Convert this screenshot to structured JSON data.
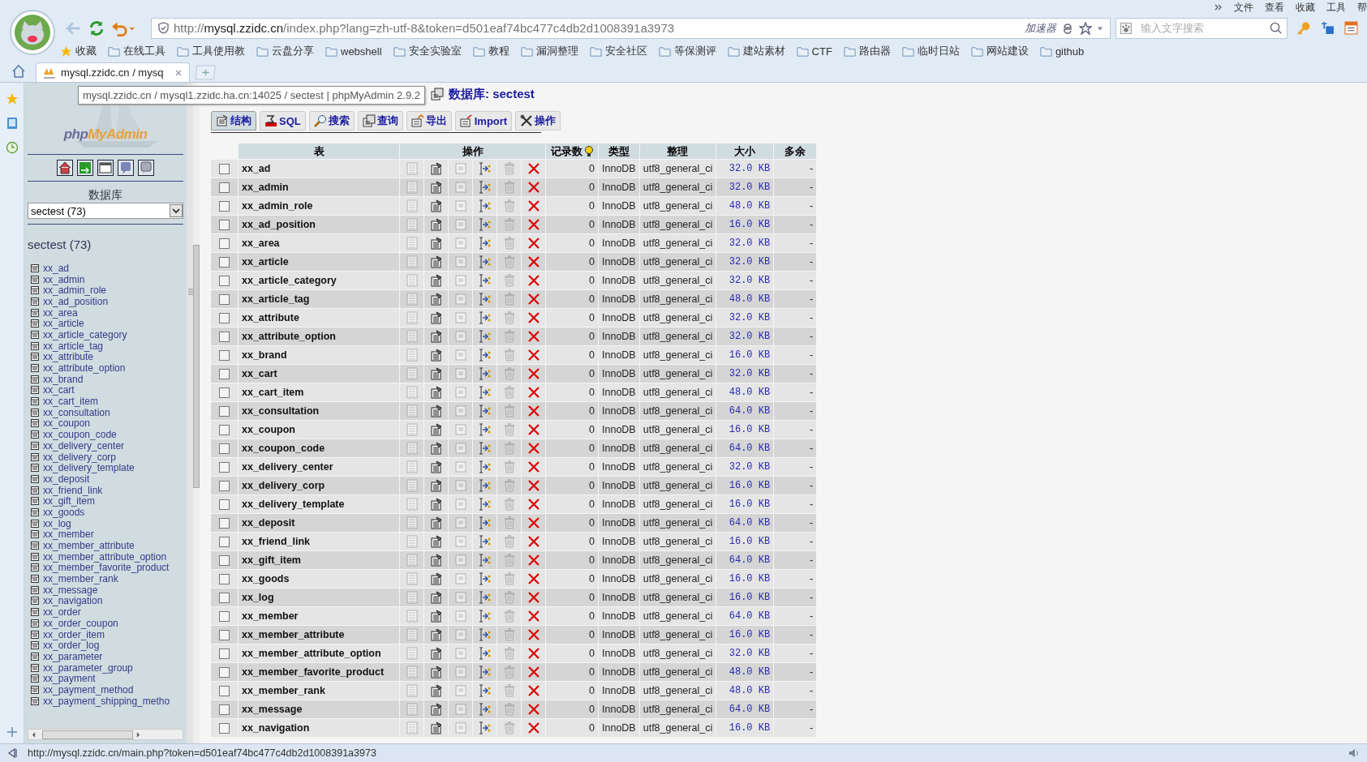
{
  "browser": {
    "menu": [
      "文件",
      "查看",
      "收藏",
      "工具",
      "帮"
    ],
    "url": {
      "scheme": "http://",
      "host": "mysql.zzidc.cn",
      "path": "/index.php?lang=zh-utf-8&token=d501eaf74bc477c4db2d1008391a3973"
    },
    "accelerator": "加速器",
    "search_placeholder": "输入文字搜索",
    "bookmarks": [
      {
        "label": "收藏",
        "kind": "favorites"
      },
      {
        "label": "在线工具",
        "kind": "folder"
      },
      {
        "label": "工具使用教",
        "kind": "folder"
      },
      {
        "label": "云盘分享",
        "kind": "folder"
      },
      {
        "label": "webshell",
        "kind": "folder"
      },
      {
        "label": "安全实验室",
        "kind": "folder"
      },
      {
        "label": "教程",
        "kind": "folder"
      },
      {
        "label": "漏洞整理",
        "kind": "folder"
      },
      {
        "label": "安全社区",
        "kind": "folder"
      },
      {
        "label": "等保测评",
        "kind": "folder"
      },
      {
        "label": "建站素材",
        "kind": "folder"
      },
      {
        "label": "CTF",
        "kind": "folder"
      },
      {
        "label": "路由器",
        "kind": "folder"
      },
      {
        "label": "临时日站",
        "kind": "folder"
      },
      {
        "label": "网站建设",
        "kind": "folder"
      },
      {
        "label": "github",
        "kind": "folder"
      }
    ],
    "tab": {
      "title": "mysql.zzidc.cn / mysq"
    },
    "tooltip": "mysql.zzidc.cn / mysql1.zzidc.ha.cn:14025 / sectest | phpMyAdmin 2.9.2",
    "status_url": "http://mysql.zzidc.cn/main.php?token=d501eaf74bc477c4db2d1008391a3973"
  },
  "sidebar": {
    "logo": [
      "php",
      "MyAdmin"
    ],
    "db_label": "数据库",
    "db_select": "sectest (73)",
    "db_heading": "sectest (73)",
    "tables": [
      "xx_ad",
      "xx_admin",
      "xx_admin_role",
      "xx_ad_position",
      "xx_area",
      "xx_article",
      "xx_article_category",
      "xx_article_tag",
      "xx_attribute",
      "xx_attribute_option",
      "xx_brand",
      "xx_cart",
      "xx_cart_item",
      "xx_consultation",
      "xx_coupon",
      "xx_coupon_code",
      "xx_delivery_center",
      "xx_delivery_corp",
      "xx_delivery_template",
      "xx_deposit",
      "xx_friend_link",
      "xx_gift_item",
      "xx_goods",
      "xx_log",
      "xx_member",
      "xx_member_attribute",
      "xx_member_attribute_option",
      "xx_member_favorite_product",
      "xx_member_rank",
      "xx_message",
      "xx_navigation",
      "xx_order",
      "xx_order_coupon",
      "xx_order_item",
      "xx_order_log",
      "xx_parameter",
      "xx_parameter_group",
      "xx_payment",
      "xx_payment_method",
      "xx_payment_shipping_metho"
    ]
  },
  "main": {
    "heading": "数据库: sectest",
    "tabs": [
      {
        "label": "结构",
        "kind": "structure",
        "selected": true
      },
      {
        "label": "SQL",
        "kind": "sql",
        "selected": false
      },
      {
        "label": "搜索",
        "kind": "search",
        "selected": false
      },
      {
        "label": "查询",
        "kind": "query",
        "selected": false
      },
      {
        "label": "导出",
        "kind": "export",
        "selected": false
      },
      {
        "label": "Import",
        "kind": "import",
        "selected": false
      },
      {
        "label": "操作",
        "kind": "operations",
        "selected": false
      }
    ],
    "table": {
      "columns": [
        "表",
        "操作",
        "记录数",
        "类型",
        "整理",
        "大小",
        "多余"
      ],
      "rows": [
        {
          "name": "xx_ad",
          "checked": false,
          "records": "0",
          "type": "InnoDB",
          "collation": "utf8_general_ci",
          "size": "32.0 KB",
          "overhead": "-"
        },
        {
          "name": "xx_admin",
          "checked": false,
          "records": "0",
          "type": "InnoDB",
          "collation": "utf8_general_ci",
          "size": "32.0 KB",
          "overhead": "-"
        },
        {
          "name": "xx_admin_role",
          "checked": false,
          "records": "0",
          "type": "InnoDB",
          "collation": "utf8_general_ci",
          "size": "48.0 KB",
          "overhead": "-"
        },
        {
          "name": "xx_ad_position",
          "checked": false,
          "records": "0",
          "type": "InnoDB",
          "collation": "utf8_general_ci",
          "size": "16.0 KB",
          "overhead": "-"
        },
        {
          "name": "xx_area",
          "checked": false,
          "records": "0",
          "type": "InnoDB",
          "collation": "utf8_general_ci",
          "size": "32.0 KB",
          "overhead": "-"
        },
        {
          "name": "xx_article",
          "checked": false,
          "records": "0",
          "type": "InnoDB",
          "collation": "utf8_general_ci",
          "size": "32.0 KB",
          "overhead": "-"
        },
        {
          "name": "xx_article_category",
          "checked": false,
          "records": "0",
          "type": "InnoDB",
          "collation": "utf8_general_ci",
          "size": "32.0 KB",
          "overhead": "-"
        },
        {
          "name": "xx_article_tag",
          "checked": false,
          "records": "0",
          "type": "InnoDB",
          "collation": "utf8_general_ci",
          "size": "48.0 KB",
          "overhead": "-"
        },
        {
          "name": "xx_attribute",
          "checked": false,
          "records": "0",
          "type": "InnoDB",
          "collation": "utf8_general_ci",
          "size": "32.0 KB",
          "overhead": "-"
        },
        {
          "name": "xx_attribute_option",
          "checked": false,
          "records": "0",
          "type": "InnoDB",
          "collation": "utf8_general_ci",
          "size": "32.0 KB",
          "overhead": "-"
        },
        {
          "name": "xx_brand",
          "checked": false,
          "records": "0",
          "type": "InnoDB",
          "collation": "utf8_general_ci",
          "size": "16.0 KB",
          "overhead": "-"
        },
        {
          "name": "xx_cart",
          "checked": false,
          "records": "0",
          "type": "InnoDB",
          "collation": "utf8_general_ci",
          "size": "32.0 KB",
          "overhead": "-"
        },
        {
          "name": "xx_cart_item",
          "checked": false,
          "records": "0",
          "type": "InnoDB",
          "collation": "utf8_general_ci",
          "size": "48.0 KB",
          "overhead": "-"
        },
        {
          "name": "xx_consultation",
          "checked": false,
          "records": "0",
          "type": "InnoDB",
          "collation": "utf8_general_ci",
          "size": "64.0 KB",
          "overhead": "-"
        },
        {
          "name": "xx_coupon",
          "checked": false,
          "records": "0",
          "type": "InnoDB",
          "collation": "utf8_general_ci",
          "size": "16.0 KB",
          "overhead": "-"
        },
        {
          "name": "xx_coupon_code",
          "checked": false,
          "records": "0",
          "type": "InnoDB",
          "collation": "utf8_general_ci",
          "size": "64.0 KB",
          "overhead": "-"
        },
        {
          "name": "xx_delivery_center",
          "checked": false,
          "records": "0",
          "type": "InnoDB",
          "collation": "utf8_general_ci",
          "size": "32.0 KB",
          "overhead": "-"
        },
        {
          "name": "xx_delivery_corp",
          "checked": false,
          "records": "0",
          "type": "InnoDB",
          "collation": "utf8_general_ci",
          "size": "16.0 KB",
          "overhead": "-"
        },
        {
          "name": "xx_delivery_template",
          "checked": false,
          "records": "0",
          "type": "InnoDB",
          "collation": "utf8_general_ci",
          "size": "16.0 KB",
          "overhead": "-"
        },
        {
          "name": "xx_deposit",
          "checked": false,
          "records": "0",
          "type": "InnoDB",
          "collation": "utf8_general_ci",
          "size": "64.0 KB",
          "overhead": "-"
        },
        {
          "name": "xx_friend_link",
          "checked": false,
          "records": "0",
          "type": "InnoDB",
          "collation": "utf8_general_ci",
          "size": "16.0 KB",
          "overhead": "-"
        },
        {
          "name": "xx_gift_item",
          "checked": false,
          "records": "0",
          "type": "InnoDB",
          "collation": "utf8_general_ci",
          "size": "64.0 KB",
          "overhead": "-"
        },
        {
          "name": "xx_goods",
          "checked": false,
          "records": "0",
          "type": "InnoDB",
          "collation": "utf8_general_ci",
          "size": "16.0 KB",
          "overhead": "-"
        },
        {
          "name": "xx_log",
          "checked": false,
          "records": "0",
          "type": "InnoDB",
          "collation": "utf8_general_ci",
          "size": "16.0 KB",
          "overhead": "-"
        },
        {
          "name": "xx_member",
          "checked": false,
          "records": "0",
          "type": "InnoDB",
          "collation": "utf8_general_ci",
          "size": "64.0 KB",
          "overhead": "-"
        },
        {
          "name": "xx_member_attribute",
          "checked": false,
          "records": "0",
          "type": "InnoDB",
          "collation": "utf8_general_ci",
          "size": "16.0 KB",
          "overhead": "-"
        },
        {
          "name": "xx_member_attribute_option",
          "checked": false,
          "records": "0",
          "type": "InnoDB",
          "collation": "utf8_general_ci",
          "size": "32.0 KB",
          "overhead": "-"
        },
        {
          "name": "xx_member_favorite_product",
          "checked": false,
          "records": "0",
          "type": "InnoDB",
          "collation": "utf8_general_ci",
          "size": "48.0 KB",
          "overhead": "-"
        },
        {
          "name": "xx_member_rank",
          "checked": false,
          "records": "0",
          "type": "InnoDB",
          "collation": "utf8_general_ci",
          "size": "48.0 KB",
          "overhead": "-"
        },
        {
          "name": "xx_message",
          "checked": false,
          "records": "0",
          "type": "InnoDB",
          "collation": "utf8_general_ci",
          "size": "64.0 KB",
          "overhead": "-"
        },
        {
          "name": "xx_navigation",
          "checked": false,
          "records": "0",
          "type": "InnoDB",
          "collation": "utf8_general_ci",
          "size": "16.0 KB",
          "overhead": "-"
        }
      ]
    }
  }
}
